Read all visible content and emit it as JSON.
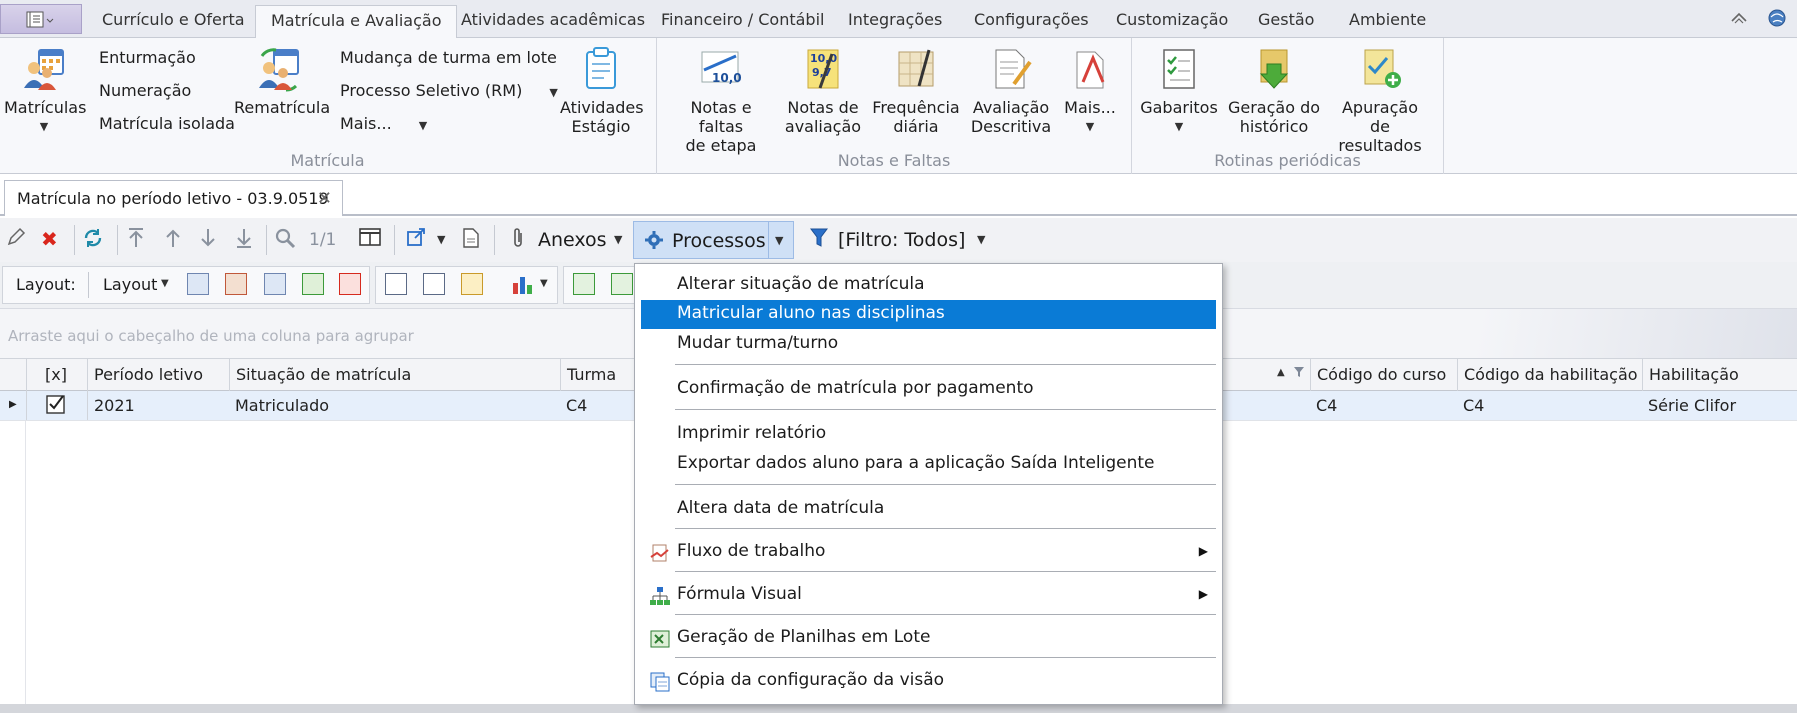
{
  "tabs": {
    "app_menu_icon": "app-menu-icon",
    "items": [
      "Currículo e Oferta",
      "Matrícula e Avaliação",
      "Atividades acadêmicas",
      "Financeiro / Contábil",
      "Integrações",
      "Configurações",
      "Customização",
      "Gestão",
      "Ambiente"
    ],
    "active_index": 1
  },
  "ribbon": {
    "matricula_group": {
      "label": "Matrícula",
      "matriculas": "Matrículas",
      "enturmacao": "Enturmação",
      "numeracao": "Numeração",
      "matricula_isolada": "Matrícula isolada",
      "rematricula": "Rematrícula",
      "mudanca_turma_lote": "Mudança de turma em lote",
      "processo_seletivo": "Processo Seletivo (RM)",
      "mais": "Mais...",
      "atividades_estagio_1": "Atividades",
      "atividades_estagio_2": "Estágio"
    },
    "notas_group": {
      "label": "Notas e Faltas",
      "notas_faltas_etapa_1": "Notas e faltas",
      "notas_faltas_etapa_2": "de etapa",
      "notas_avaliacao_1": "Notas de",
      "notas_avaliacao_2": "avaliação",
      "frequencia_1": "Frequência",
      "frequencia_2": "diária",
      "avaliacao_descritiva_1": "Avaliação",
      "avaliacao_descritiva_2": "Descritiva",
      "mais": "Mais...",
      "notas_icon_text_1": "10,0",
      "notas_icon_text_2": "9,7",
      "notas_icon_text_3": "10,0"
    },
    "rotinas_group": {
      "label": "Rotinas periódicas",
      "gabaritos": "Gabaritos",
      "geracao_historico_1": "Geração do",
      "geracao_historico_2": "histórico",
      "apuracao_1": "Apuração de",
      "apuracao_2": "resultados"
    }
  },
  "document_tab": {
    "title": "Matrícula no período letivo - 03.9.0519"
  },
  "toolbar": {
    "pager": "1/1",
    "anexos": "Anexos",
    "processos": "Processos",
    "filtro": "[Filtro: Todos]"
  },
  "layout_bar": {
    "layout_label": "Layout:",
    "layout_dropdown": "Layout"
  },
  "group_panel": {
    "hint": "Arraste aqui o cabeçalho de uma coluna para agrupar"
  },
  "grid": {
    "columns": [
      "[x]",
      "Período letivo",
      "Situação de matrícula",
      "Turma",
      "Código do curso",
      "Código da habilitação",
      "Habilitação"
    ],
    "row": {
      "checked": true,
      "periodo": "2021",
      "situacao": "Matriculado",
      "turma": "C4",
      "codigo_curso": "C4",
      "codigo_habilitacao": "C4",
      "habilitacao": "Série Clifor"
    }
  },
  "processos_menu": {
    "items": [
      "Alterar situação de matrícula",
      "Matricular aluno nas disciplinas",
      "Mudar turma/turno",
      "Confirmação de matrícula por pagamento",
      "Imprimir relatório",
      "Exportar dados aluno para a aplicação Saída Inteligente",
      "Altera data de matrícula",
      "Fluxo de trabalho",
      "Fórmula Visual",
      "Geração de Planilhas em Lote",
      "Cópia da configuração da visão"
    ],
    "highlighted_index": 1
  },
  "colors": {
    "menu_highlight": "#0a7bd6",
    "processos_active": "#cfe0f6",
    "delete_red": "#d9261c"
  }
}
